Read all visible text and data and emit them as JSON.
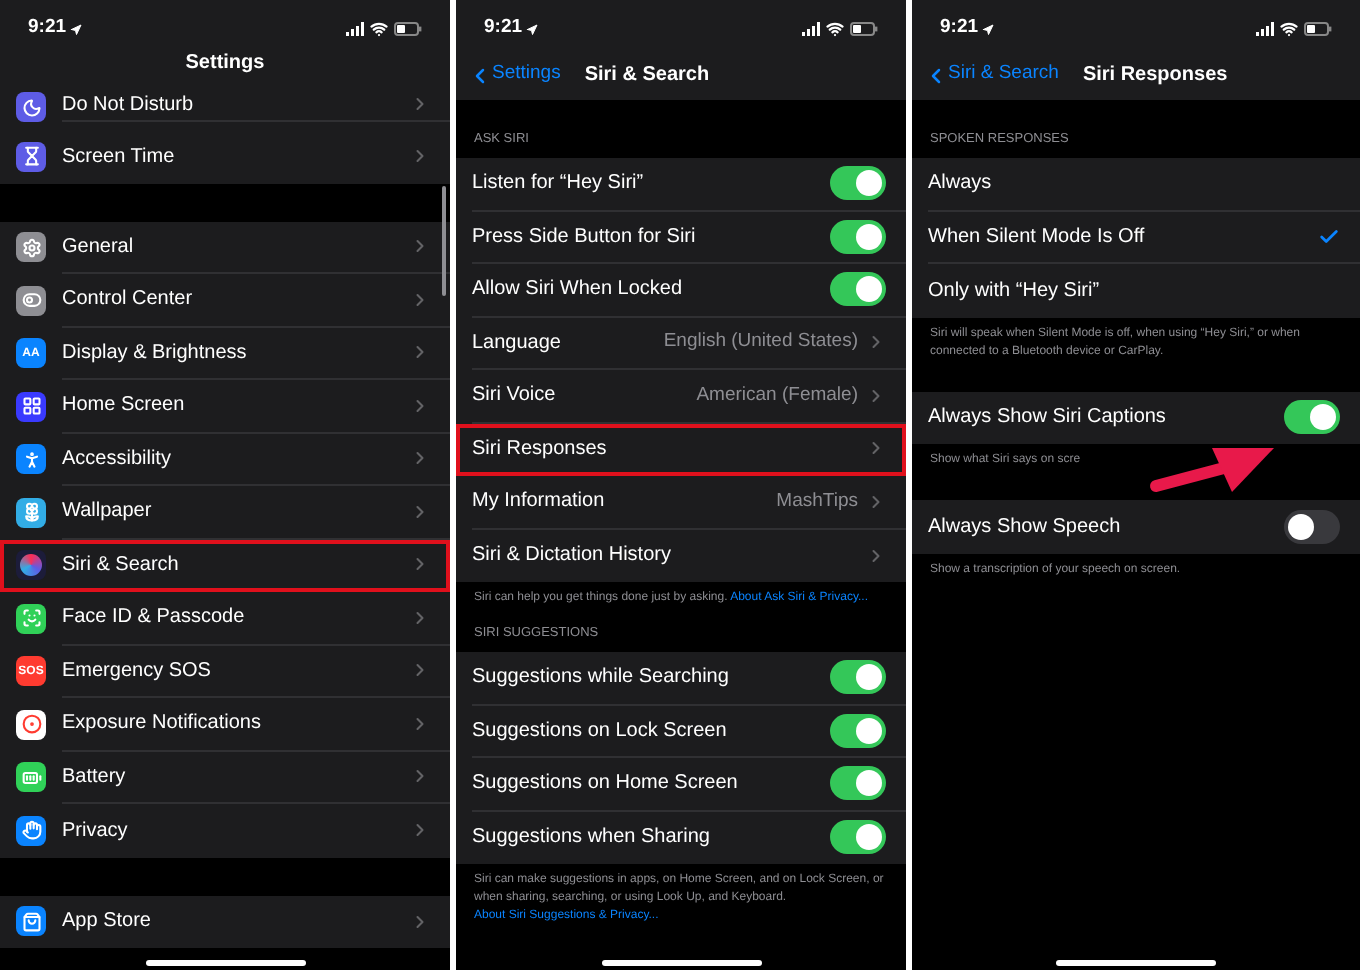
{
  "panels": [
    {
      "time": "9:21",
      "title": "Settings",
      "groups": [
        {
          "rows": [
            {
              "label": "Do Not Disturb",
              "kind": "link",
              "highlighted": false
            },
            {
              "label": "Screen Time",
              "kind": "link",
              "highlighted": false
            }
          ]
        },
        {
          "rows": [
            {
              "label": "General",
              "kind": "link",
              "highlighted": false
            },
            {
              "label": "Control Center",
              "kind": "link",
              "highlighted": false
            },
            {
              "label": "Display & Brightness",
              "kind": "link",
              "highlighted": false,
              "icon_text": "AA"
            },
            {
              "label": "Home Screen",
              "kind": "link",
              "highlighted": false
            },
            {
              "label": "Accessibility",
              "kind": "link",
              "highlighted": false
            },
            {
              "label": "Wallpaper",
              "kind": "link",
              "highlighted": false
            },
            {
              "label": "Siri & Search",
              "kind": "link",
              "highlighted": true
            },
            {
              "label": "Face ID & Passcode",
              "kind": "link",
              "highlighted": false
            },
            {
              "label": "Emergency SOS",
              "kind": "link",
              "highlighted": false,
              "icon_text": "SOS"
            },
            {
              "label": "Exposure Notifications",
              "kind": "link",
              "highlighted": false
            },
            {
              "label": "Battery",
              "kind": "link",
              "highlighted": false
            },
            {
              "label": "Privacy",
              "kind": "link",
              "highlighted": false
            }
          ]
        },
        {
          "rows": [
            {
              "label": "App Store",
              "kind": "link",
              "highlighted": false
            }
          ]
        }
      ]
    },
    {
      "time": "9:21",
      "back": "Settings",
      "title": "Siri & Search",
      "groups": [
        {
          "header": "ASK SIRI",
          "rows": [
            {
              "label": "Listen for “Hey Siri”",
              "kind": "toggle",
              "on": true
            },
            {
              "label": "Press Side Button for Siri",
              "kind": "toggle",
              "on": true
            },
            {
              "label": "Allow Siri When Locked",
              "kind": "toggle",
              "on": true
            },
            {
              "label": "Language",
              "kind": "link",
              "value": "English (United States)",
              "highlighted": false
            },
            {
              "label": "Siri Voice",
              "kind": "link",
              "value": "American (Female)",
              "highlighted": false
            },
            {
              "label": "Siri Responses",
              "kind": "link",
              "highlighted": true
            },
            {
              "label": "My Information",
              "kind": "link",
              "value": "MashTips",
              "highlighted": false
            },
            {
              "label": "Siri & Dictation History",
              "kind": "link",
              "highlighted": false
            }
          ],
          "footer": {
            "text": "Siri can help you get things done just by asking.",
            "link": "About Ask Siri & Privacy..."
          }
        },
        {
          "header": "SIRI SUGGESTIONS",
          "rows": [
            {
              "label": "Suggestions while Searching",
              "kind": "toggle",
              "on": true
            },
            {
              "label": "Suggestions on Lock Screen",
              "kind": "toggle",
              "on": true
            },
            {
              "label": "Suggestions on Home Screen",
              "kind": "toggle",
              "on": true
            },
            {
              "label": "Suggestions when Sharing",
              "kind": "toggle",
              "on": true
            }
          ],
          "footer": {
            "text": "Siri can make suggestions in apps, on Home Screen, and on Lock Screen, or when sharing, searching, or using Look Up, and Keyboard.",
            "link": "About Siri Suggestions & Privacy..."
          }
        }
      ]
    },
    {
      "time": "9:21",
      "back": "Siri & Search",
      "title": "Siri Responses",
      "groups": [
        {
          "header": "SPOKEN RESPONSES",
          "rows": [
            {
              "label": "Always",
              "kind": "option",
              "selected": false
            },
            {
              "label": "When Silent Mode Is Off",
              "kind": "option",
              "selected": true
            },
            {
              "label": "Only with “Hey Siri”",
              "kind": "option",
              "selected": false
            }
          ],
          "footer": {
            "text": "Siri will speak when Silent Mode is off, when using “Hey Siri,” or when connected to a Bluetooth device or CarPlay."
          }
        },
        {
          "rows": [
            {
              "label": "Always Show Siri Captions",
              "kind": "toggle",
              "on": true,
              "pointed_at": true
            }
          ],
          "footer": {
            "text": "Show what Siri says on scre"
          }
        },
        {
          "rows": [
            {
              "label": "Always Show Speech",
              "kind": "toggle",
              "on": false,
              "pointed_at": false
            }
          ],
          "footer": {
            "text": "Show a transcription of your speech on screen."
          }
        }
      ]
    }
  ]
}
